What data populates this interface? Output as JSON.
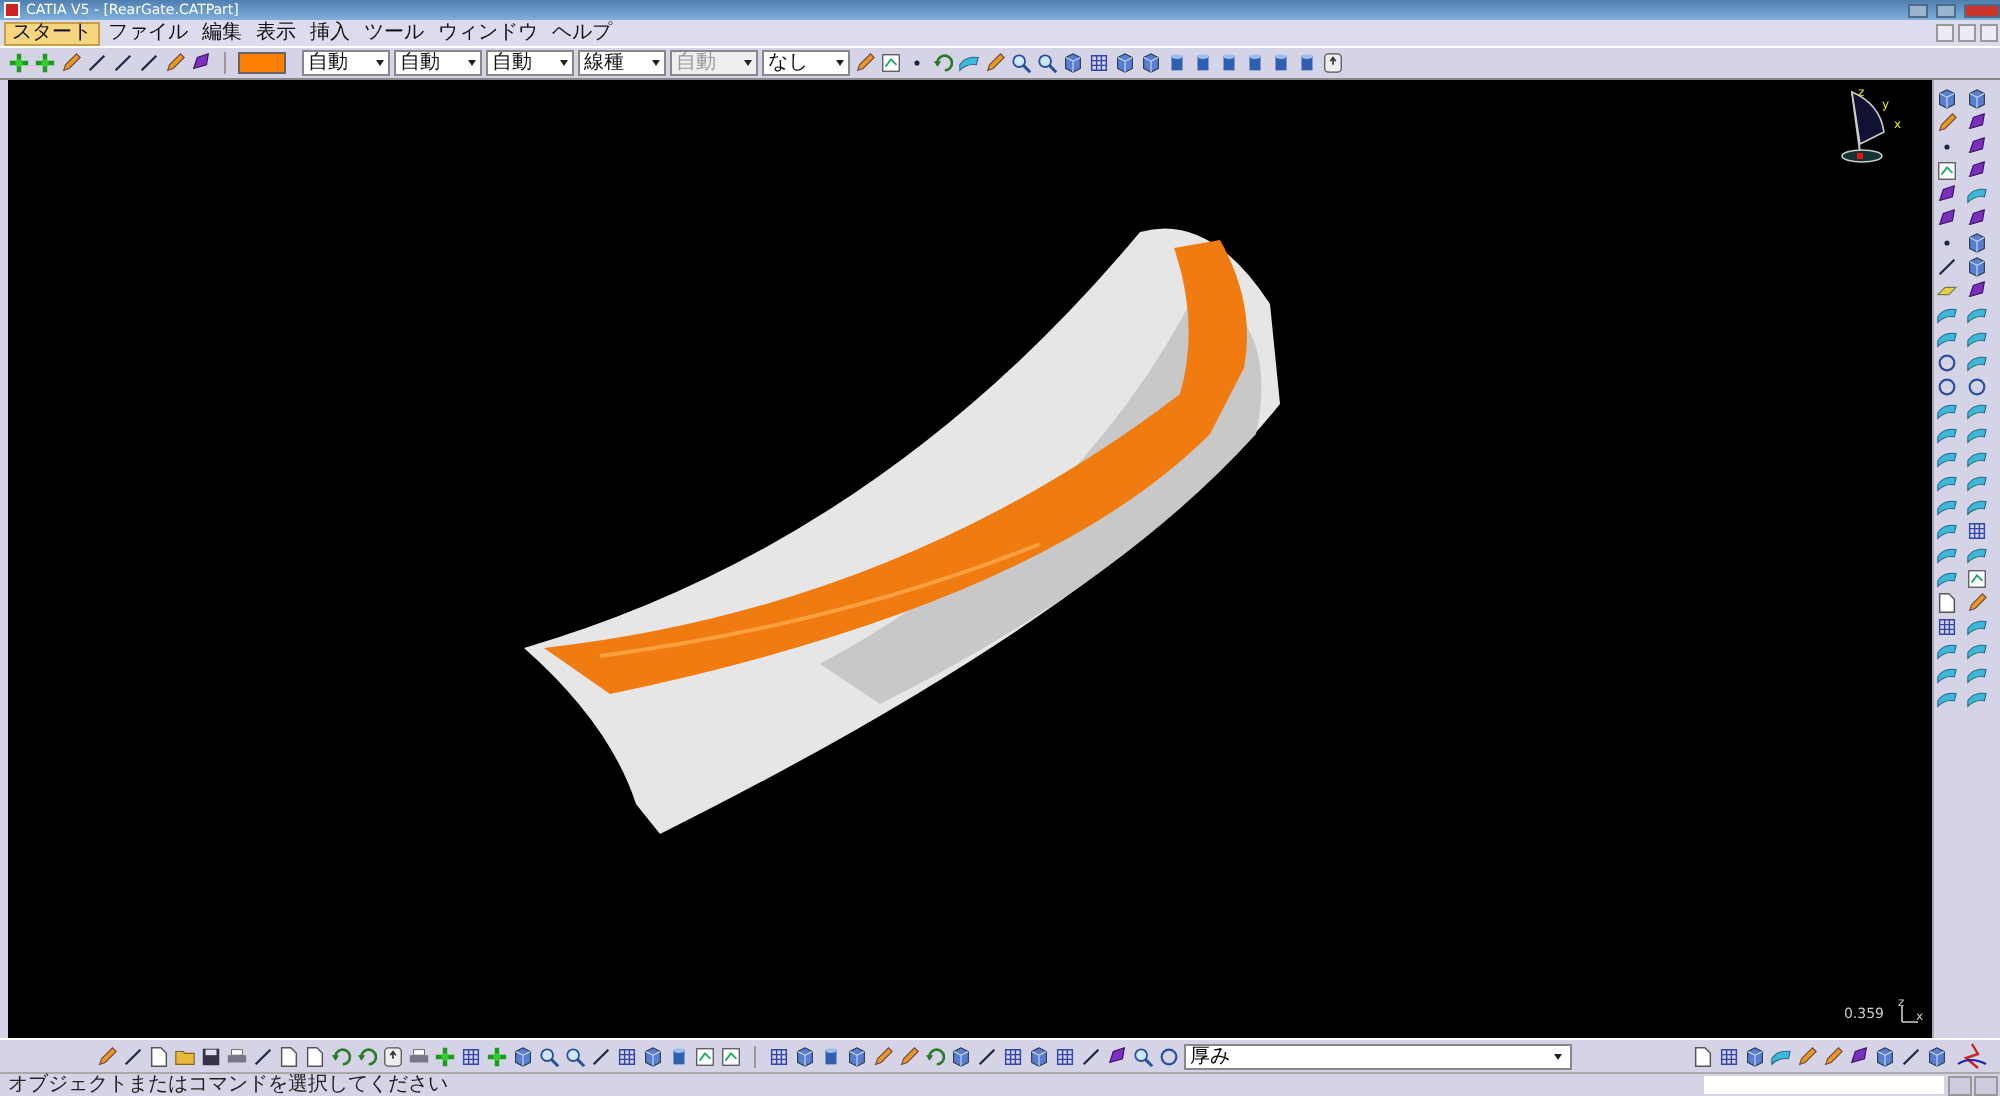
{
  "window": {
    "title": "CATIA V5 - [RearGate.CATPart]"
  },
  "menu": [
    {
      "label": "スタート",
      "selected": true
    },
    {
      "label": "ファイル",
      "selected": false
    },
    {
      "label": "編集",
      "selected": false
    },
    {
      "label": "表示",
      "selected": false
    },
    {
      "label": "挿入",
      "selected": false
    },
    {
      "label": "ツール",
      "selected": false
    },
    {
      "label": "ウィンドウ",
      "selected": false
    },
    {
      "label": "ヘルプ",
      "selected": false
    }
  ],
  "graphic_properties": [
    {
      "value": "自動",
      "disabled": false
    },
    {
      "value": "自動",
      "disabled": false
    },
    {
      "value": "自動",
      "disabled": false
    },
    {
      "value": "線種",
      "disabled": false
    },
    {
      "value": "自動",
      "disabled": true
    },
    {
      "value": "なし",
      "disabled": false
    }
  ],
  "viewport": {
    "compass_axes": [
      "z",
      "y",
      "x"
    ],
    "scale": "0.359",
    "corner_axes": [
      "z",
      "x"
    ]
  },
  "bottom_toolbar": {
    "dropdown": "厚み"
  },
  "status_bar": {
    "message": "オブジェクトまたはコマンドを選択してください"
  }
}
